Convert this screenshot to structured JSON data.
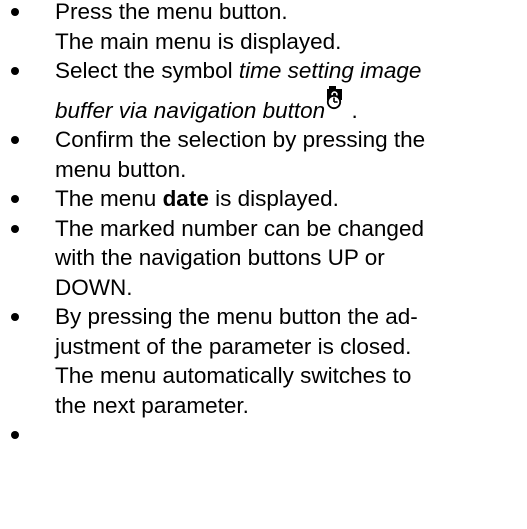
{
  "steps": [
    {
      "line1": "Press the menu button.",
      "line2": "The main menu is displayed."
    },
    {
      "line1_plain": "Select the symbol ",
      "line1_italic": "time setting image",
      "line2_italic": "buffer via navigation button",
      "line2_tail": " .",
      "icon": "camera-clock-icon"
    },
    {
      "line1": "Confirm the selection by pressing the",
      "line2": "menu button."
    },
    {
      "pre": "The menu ",
      "bold": "date",
      "post": " is displayed."
    },
    {
      "line1": "The marked number can be changed",
      "line2": "with the navigation buttons UP or",
      "line3": "DOWN."
    },
    {
      "line1": "By pressing the menu button the ad-",
      "line2": "justment of the parameter is closed.",
      "line3": "The menu automatically switches to",
      "line4": "the next parameter."
    },
    {
      "text": ""
    }
  ]
}
